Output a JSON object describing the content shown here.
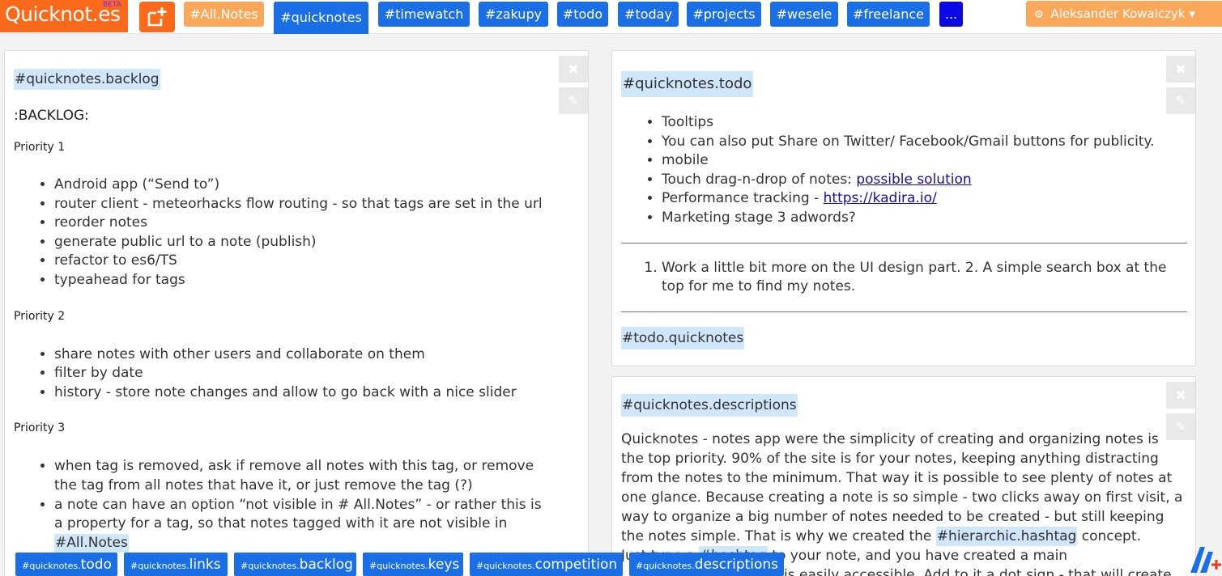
{
  "app": {
    "logo_text": "Quicknot.es",
    "beta_label": "BETA",
    "new_note_icon": "new-note-icon"
  },
  "header": {
    "tags": [
      {
        "label": "#All.Notes"
      },
      {
        "label": "#quicknotes"
      },
      {
        "label": "#timewatch"
      },
      {
        "label": "#zakupy"
      },
      {
        "label": "#todo"
      },
      {
        "label": "#today"
      },
      {
        "label": "#projects"
      },
      {
        "label": "#wesele"
      },
      {
        "label": "#freelance"
      },
      {
        "label": "..."
      }
    ],
    "user_name": "Aleksander Kowalczyk",
    "user_icon": "gear-icon",
    "user_caret": "▾"
  },
  "colors": {
    "brand_orange": "#fb6a1b",
    "light_orange": "#fba85a",
    "tag_blue": "#1a6fe6",
    "more_blue": "#0b08e6",
    "hashtag_highlight": "#cfe6fb"
  },
  "notes": {
    "backlog": {
      "tag": "#quicknotes.backlog",
      "title": ":BACKLOG:",
      "priority1": "Priority 1",
      "p1_items": [
        "Android app (“Send to”)",
        "router client - meteorhacks flow routing - so that tags are set in the url",
        "reorder notes",
        "generate public url to a note (publish)",
        "refactor to es6/TS",
        "typeahead for tags"
      ],
      "priority2": "Priority 2",
      "p2_items": [
        "share notes with other users and collaborate on them",
        "filter by date",
        "history - store note changes and allow to go back with a nice slider"
      ],
      "priority3": "Priority 3",
      "p3_item1": "when tag is removed, ask if remove all notes with this tag, or remove the tag from all notes that have it, or just remove the tag (?)",
      "p3_item2_text": "a note can have an option “not visible in # All.Notes” - or rather this is a property for a tag, so that notes tagged with it are not visible in",
      "p3_item2_tag": "#All.Notes"
    },
    "todo": {
      "tag": "#quicknotes.todo",
      "items": [
        {
          "text": "Tooltips"
        },
        {
          "text": "You can also put Share on Twitter/ Facebook/Gmail buttons for publicity."
        },
        {
          "text": "mobile"
        }
      ],
      "drag_text": "Touch drag-n-drop of notes: ",
      "drag_link": "possible solution",
      "perf_text": "Performance tracking - ",
      "perf_link": "https://kadira.io/",
      "marketing": "Marketing stage 3 adwords?",
      "numbered_item": "Work a little bit more on the UI design part. 2. A simple search box at the top for me to find my notes.",
      "footer_tag": "#todo.quicknotes"
    },
    "descriptions": {
      "tag": "#quicknotes.descriptions",
      "paragraph": "Quicknotes - notes app were the simplicity of creating and organizing notes is the top priority. 90% of the site is for your notes, keeping anything distracting from the notes to the minimum. That way it is possible to see plenty of notes at one glance. Because creating a note is so simple - two clicks away on first visit, a way to organize a big number of notes needed to be created - but still keeping the notes simple. That is why we created the",
      "inline_tag": "#hierarchic.hashtag",
      "after_tag": "concept.",
      "line2_pre": "Just type a",
      "line2_tag": "#hashtag",
      "line2_post": "to your note, and you have created a main",
      "line3": "is easily accessible. Add to it a dot sign - that will create a"
    }
  },
  "bottom_tags": [
    {
      "prefix": "#quicknotes.",
      "suffix": "todo"
    },
    {
      "prefix": "#quicknotes.",
      "suffix": "links"
    },
    {
      "prefix": "#quicknotes.",
      "suffix": "backlog"
    },
    {
      "prefix": "#quicknotes.",
      "suffix": "keys"
    },
    {
      "prefix": "#quicknotes.",
      "suffix": "competition"
    },
    {
      "prefix": "#quicknotes.",
      "suffix": "descriptions"
    }
  ]
}
